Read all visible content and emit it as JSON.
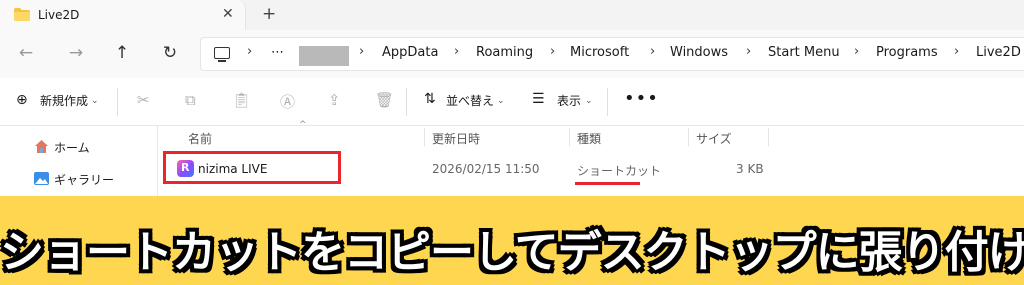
{
  "tab": {
    "title": "Live2D",
    "close": "✕",
    "new": "+"
  },
  "nav": {
    "back": "←",
    "forward": "→",
    "up": "↑",
    "refresh": "↻"
  },
  "address": {
    "overflow": "⋯",
    "crumbs": [
      "AppData",
      "Roaming",
      "Microsoft",
      "Windows",
      "Start Menu",
      "Programs",
      "Live2D"
    ],
    "separator": "›"
  },
  "commands": {
    "new_label": "新規作成",
    "sort_label": "並べ替え",
    "view_label": "表示",
    "more": "•••"
  },
  "sidebar": {
    "items": [
      {
        "label": "ホーム",
        "icon": "home-icon"
      },
      {
        "label": "ギャラリー",
        "icon": "gallery-icon"
      }
    ]
  },
  "columns": {
    "name": "名前",
    "date": "更新日時",
    "type": "種類",
    "size": "サイズ"
  },
  "file": {
    "name": "nizima LIVE",
    "date": "2026/02/15 11:50",
    "type": "ショートカット",
    "size": "3 KB"
  },
  "banner": {
    "text": "ショートカットをコピーしてデスクトップに張り付け"
  },
  "colors": {
    "accent_red": "#e8262d",
    "banner_bg": "#ffd64f"
  }
}
